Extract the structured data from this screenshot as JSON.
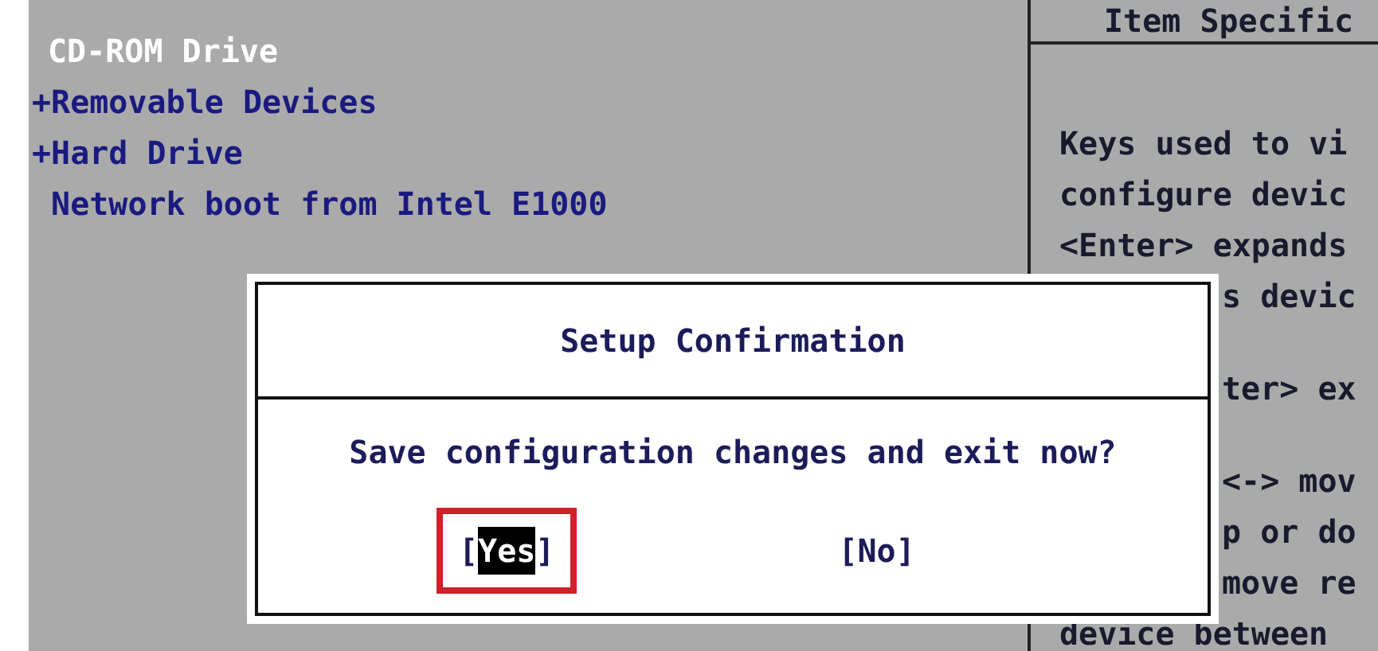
{
  "boot_menu": {
    "items": [
      {
        "label": "CD-ROM Drive",
        "selected": true
      },
      {
        "label": "+Removable Devices",
        "selected": false
      },
      {
        "label": "+Hard Drive",
        "selected": false
      },
      {
        "label": " Network boot from Intel E1000",
        "selected": false
      }
    ]
  },
  "help_panel": {
    "title": "Item Specific",
    "paragraphs": [
      [
        {
          "text": "Keys used to vi",
          "kind": "full"
        },
        {
          "text": "configure devic",
          "kind": "full"
        },
        {
          "text": "<Enter> expands",
          "kind": "full"
        },
        {
          "text": "s devic",
          "kind": "clipped"
        }
      ],
      [
        {
          "text": "ter> ex",
          "kind": "clipped"
        }
      ],
      [
        {
          "text": "<-> mov",
          "kind": "clipped"
        },
        {
          "text": "p or do",
          "kind": "clipped"
        },
        {
          "text": "move re",
          "kind": "clipped"
        },
        {
          "text": "device between",
          "kind": "full"
        }
      ]
    ]
  },
  "dialog": {
    "title": "Setup Confirmation",
    "message": "Save configuration changes and exit now?",
    "buttons": [
      {
        "open": "[",
        "label": "Yes",
        "close": "]",
        "selected": true
      },
      {
        "open": "[",
        "label": "No",
        "close": "]",
        "selected": false
      }
    ]
  }
}
